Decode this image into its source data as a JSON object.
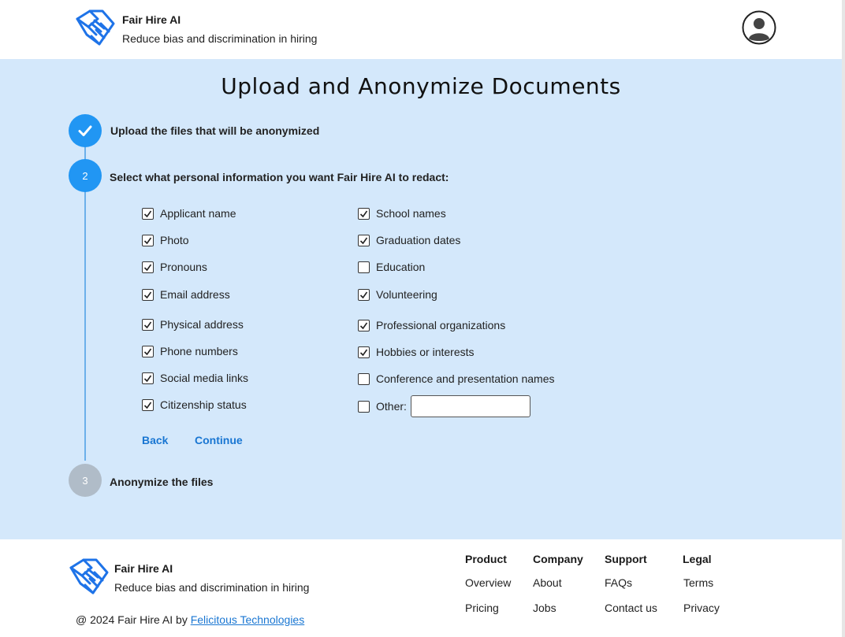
{
  "header": {
    "brand_name": "Fair Hire AI",
    "tagline": "Reduce bias and discrimination in hiring"
  },
  "main": {
    "title": "Upload and Anonymize Documents",
    "steps": [
      {
        "number": "",
        "label": "Upload the files that will be anonymized",
        "status": "done"
      },
      {
        "number": "2",
        "label": "Select what personal information you want Fair Hire AI to redact:",
        "status": "active"
      },
      {
        "number": "3",
        "label": "Anonymize the files",
        "status": "pending"
      }
    ],
    "options_left": [
      {
        "label": "Applicant name",
        "checked": true
      },
      {
        "label": "Photo",
        "checked": true
      },
      {
        "label": "Pronouns",
        "checked": true
      },
      {
        "label": "Email address",
        "checked": true
      },
      {
        "label": "Physical address",
        "checked": true
      },
      {
        "label": "Phone numbers",
        "checked": true
      },
      {
        "label": "Social media links",
        "checked": true
      },
      {
        "label": "Citizenship status",
        "checked": true
      }
    ],
    "options_right": [
      {
        "label": "School names",
        "checked": true
      },
      {
        "label": "Graduation dates",
        "checked": true
      },
      {
        "label": "Education",
        "checked": false
      },
      {
        "label": "Volunteering",
        "checked": true
      },
      {
        "label": "Professional organizations",
        "checked": true
      },
      {
        "label": "Hobbies or interests",
        "checked": true
      },
      {
        "label": "Conference and presentation names",
        "checked": false
      },
      {
        "label": "Other:",
        "checked": false
      }
    ],
    "other_value": "",
    "back_label": "Back",
    "continue_label": "Continue"
  },
  "footer": {
    "brand_name": "Fair Hire AI",
    "tagline": "Reduce bias and discrimination in hiring",
    "copyright_prefix": "@ 2024 Fair Hire AI by ",
    "copyright_link": "Felicitous Technologies",
    "columns": [
      {
        "heading": "Product",
        "links": [
          "Overview",
          "Pricing"
        ]
      },
      {
        "heading": "Company",
        "links": [
          "About",
          "Jobs"
        ]
      },
      {
        "heading": "Support",
        "links": [
          "FAQs",
          "Contact us"
        ]
      },
      {
        "heading": "Legal",
        "links": [
          "Terms",
          "Privacy"
        ]
      }
    ]
  },
  "colors": {
    "accent": "#2196f3",
    "background_main": "#d4e8fb",
    "link": "#1976d2",
    "pending_step": "#b0bcc8"
  },
  "icons": {
    "logo": "handshake-logo-icon",
    "avatar": "user-avatar-icon",
    "step_done": "checkmark-icon"
  }
}
